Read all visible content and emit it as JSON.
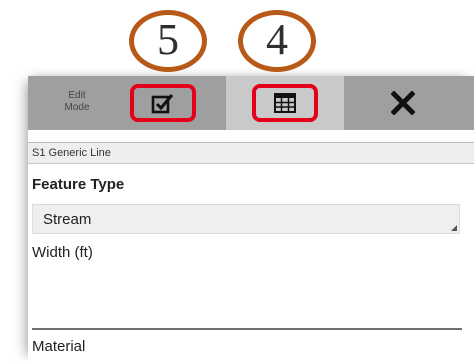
{
  "callouts": [
    "5",
    "4"
  ],
  "toolbar": {
    "edit_mode_line1": "Edit",
    "edit_mode_line2": "Mode",
    "icons": [
      "checkbox-check-icon",
      "table-grid-icon",
      "close-x-icon"
    ]
  },
  "form": {
    "title": "S1 Generic Line",
    "feature_type_label": "Feature Type",
    "feature_type_value": "Stream",
    "width_label": "Width (ft)",
    "width_value": "",
    "material_label": "Material"
  },
  "colors": {
    "callout_ring": "#b85a17",
    "highlight_red": "#e4001b",
    "toolbar_gray": "#9f9f9f",
    "active_tab_gray": "#c9c9c9"
  }
}
